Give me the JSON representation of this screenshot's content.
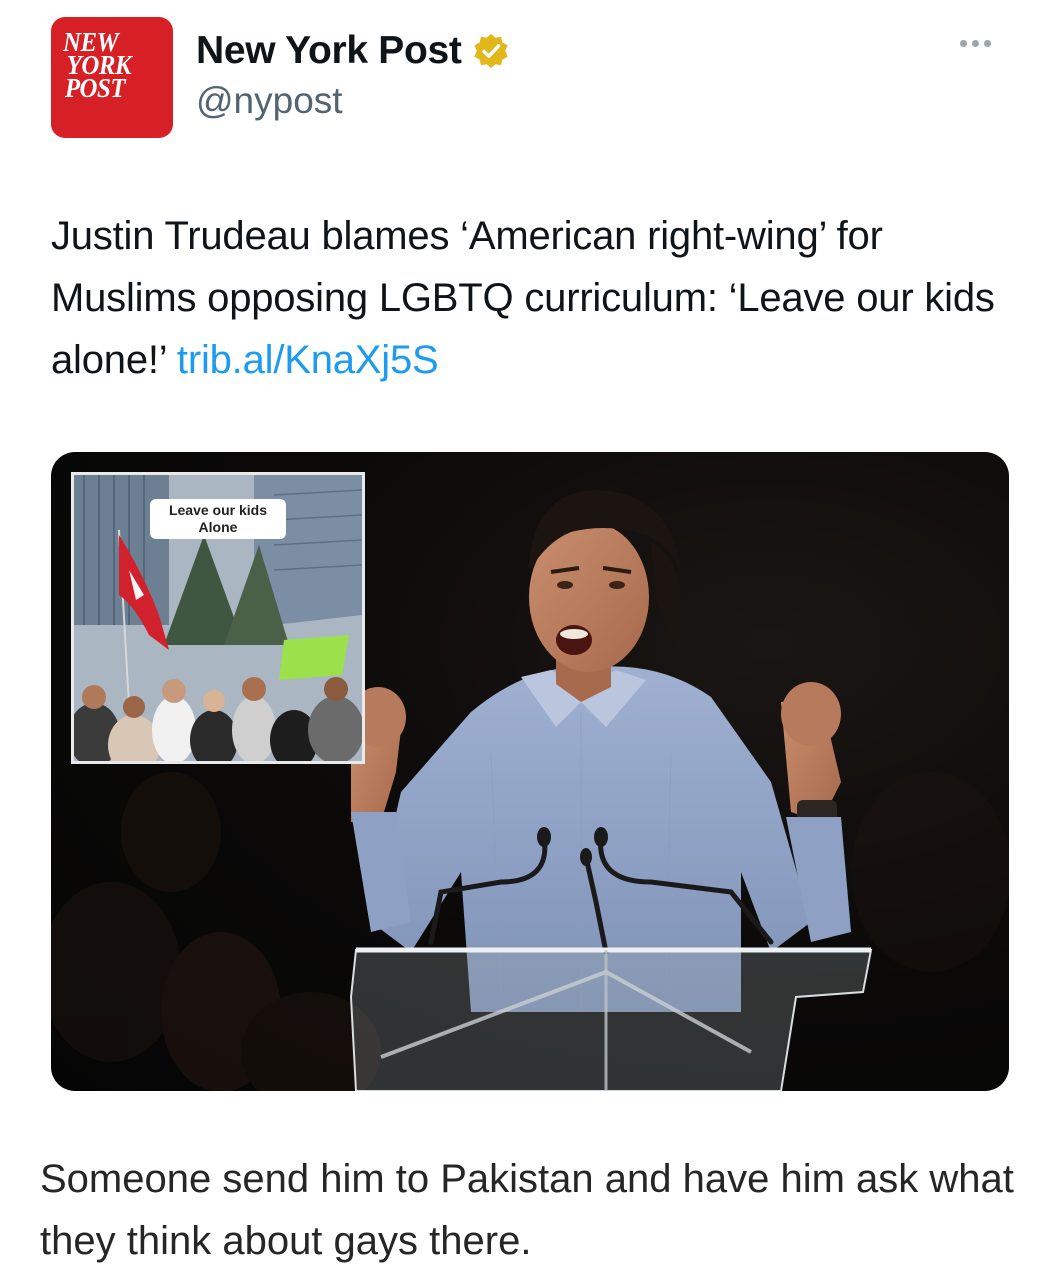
{
  "account": {
    "logo_lines": [
      "NEW",
      "YORK",
      "POST"
    ],
    "display_name": "New York Post",
    "handle": "@nypost",
    "verified_icon": "verified-gold-badge-icon",
    "more_icon": "more-options-icon"
  },
  "tweet": {
    "text": "Justin Trudeau blames ‘American right-wing’ for Muslims opposing LGBTQ curriculum: ‘Leave our kids alone!’ ",
    "link": "trib.al/KnaXj5S"
  },
  "media": {
    "inset_caption_line1": "Leave our kids",
    "inset_caption_line2": "Alone"
  },
  "comment": {
    "text": "Someone send him to Pakistan and have him ask what they think about gays there."
  },
  "colors": {
    "brand_red": "#d71f26",
    "link_blue": "#1d9bf0",
    "verified_gold": "#e2b719"
  }
}
